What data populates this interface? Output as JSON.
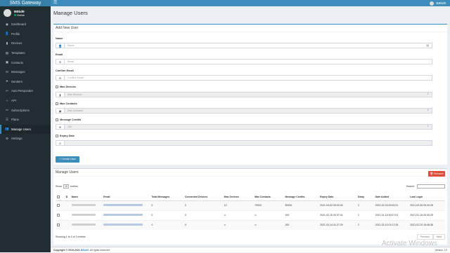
{
  "app": {
    "brand": "SMS Gateway",
    "user": "BBbd9"
  },
  "sidebar": {
    "profile_name": "BBbd9",
    "status": "Online",
    "items": [
      {
        "label": "Dashboard",
        "icon": "dashboard-icon"
      },
      {
        "label": "Profile",
        "icon": "user-icon"
      },
      {
        "label": "Devices",
        "icon": "mobile-icon"
      },
      {
        "label": "Templates",
        "icon": "file-icon"
      },
      {
        "label": "Contacts",
        "icon": "address-book-icon"
      },
      {
        "label": "Messages",
        "icon": "envelope-icon"
      },
      {
        "label": "Senders",
        "icon": "paper-plane-icon"
      },
      {
        "label": "Auto Responder",
        "icon": "reply-icon"
      },
      {
        "label": "API",
        "icon": "code-icon"
      },
      {
        "label": "Subscriptions",
        "icon": "credit-card-icon"
      },
      {
        "label": "Plans",
        "icon": "list-icon"
      },
      {
        "label": "Manage Users",
        "icon": "users-icon",
        "active": true
      },
      {
        "label": "Settings",
        "icon": "gear-icon"
      }
    ]
  },
  "page": {
    "title": "Manage Users"
  },
  "add_user": {
    "header": "Add New User",
    "name_label": "Name",
    "name_placeholder": "Name",
    "email_label": "Email",
    "email_placeholder": "Email",
    "confirm_label": "Confirm Email",
    "confirm_placeholder": "Confirm Email",
    "max_devices_label": "Max Devices",
    "max_devices_value": "Max Devices",
    "max_contacts_label": "Max Contacts",
    "max_contacts_value": "Max Contacts",
    "credits_label": "Message Credits",
    "credits_value": "100",
    "expiry_label": "Expiry Date",
    "create_button": "Create User"
  },
  "manage": {
    "header": "Manage Users",
    "remove_button": "Remove",
    "show_label": "Show",
    "entries_value": "10",
    "entries_label": "entries",
    "search_label": "Search:",
    "columns": [
      "Name",
      "Email",
      "Total Messages",
      "Connected Devices",
      "Max Devices",
      "Max Contacts",
      "Message Credits",
      "Expiry Date",
      "Delay",
      "Date Added",
      "Last Login"
    ],
    "rows": [
      {
        "total": "0",
        "connected": "0",
        "max_devices": "10",
        "max_contacts": "70000",
        "credits": "50000",
        "expiry": "2021-04-02 00:00:00",
        "delay": "2",
        "added": "2021-02-03 00:00:21",
        "login": "2021-02-06 09:33:28"
      },
      {
        "total": "0",
        "connected": "0",
        "max_devices": "∞",
        "max_contacts": "∞",
        "credits": "200",
        "expiry": "2021-02-15 00:07:01",
        "delay": "2",
        "added": "2021-01-16 00:07:01",
        "login": "2021-01-16 00:40:29"
      },
      {
        "total": "0",
        "connected": "0",
        "max_devices": "∞",
        "max_contacts": "∞",
        "credits": "200",
        "expiry": "2021-03-14 01:27:29",
        "delay": "2",
        "added": "2021-02-10 01:27:25",
        "login": "2021-02-20 15:48:38"
      }
    ],
    "info": "Showing 1 to 3 of 3 entries",
    "prev": "Previous",
    "next": "Next"
  },
  "footer": {
    "copyright": "Copyright © 2019-2021",
    "brand": "BBbd9",
    "rights": ". All rights reserved.",
    "version": "Version 1.0"
  },
  "watermark": "Activate Windows"
}
